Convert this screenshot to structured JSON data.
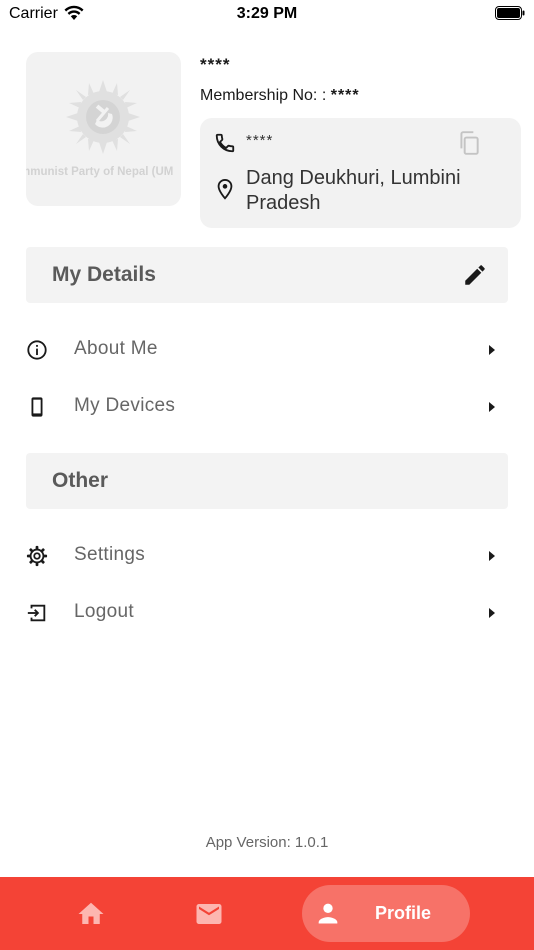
{
  "status_bar": {
    "carrier": "Carrier",
    "time": "3:29 PM"
  },
  "profile": {
    "logo_caption": "mmunist Party of Nepal (UM",
    "name": "****",
    "membership_label": "Membership No: :",
    "membership_value": "****",
    "phone": "****",
    "address": "Dang Deukhuri, Lumbini Pradesh"
  },
  "sections": {
    "my_details": {
      "title": "My Details",
      "items": [
        {
          "label": "About Me",
          "icon": "info-icon"
        },
        {
          "label": "My Devices",
          "icon": "phone-device-icon"
        }
      ]
    },
    "other": {
      "title": "Other",
      "items": [
        {
          "label": "Settings",
          "icon": "gear-icon"
        },
        {
          "label": "Logout",
          "icon": "logout-icon"
        }
      ]
    }
  },
  "app_version": "App Version: 1.0.1",
  "bottom_nav": {
    "items": [
      {
        "icon": "home-icon"
      },
      {
        "icon": "mail-icon"
      },
      {
        "icon": "person-icon",
        "label": "Profile",
        "active": true
      }
    ]
  },
  "colors": {
    "accent": "#f44336",
    "card_bg": "#f2f2f2",
    "muted_text": "#666666"
  }
}
